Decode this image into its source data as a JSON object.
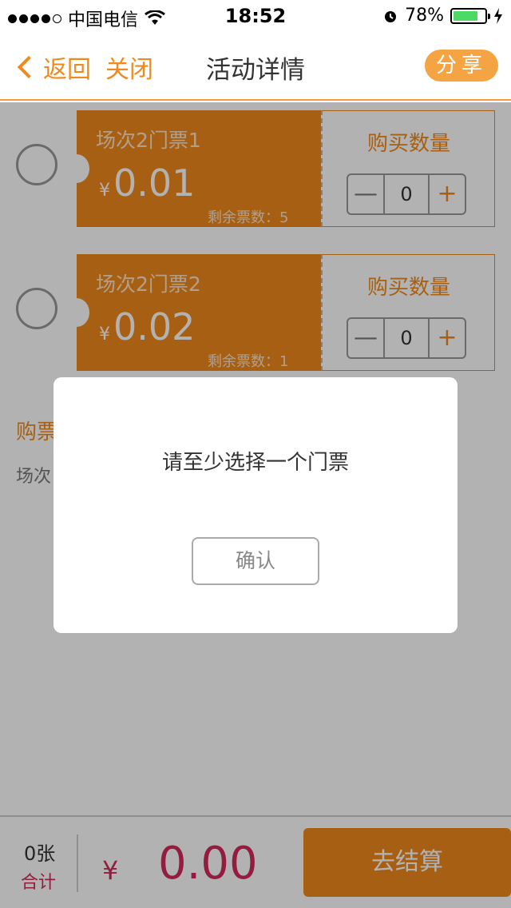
{
  "status_bar": {
    "carrier": "中国电信",
    "time": "18:52",
    "battery_percent": "78%",
    "battery_level": 0.78,
    "signal_dots_filled": 4
  },
  "nav": {
    "back_label": "返回",
    "close_label": "关闭",
    "title": "活动详情",
    "share_label": "分享"
  },
  "tickets": [
    {
      "name": "场次2门票1",
      "currency": "¥",
      "price": "0.01",
      "remaining": "剩余票数：5",
      "qty_label": "购买数量",
      "quantity": "0",
      "minus": "—",
      "plus": "+"
    },
    {
      "name": "场次2门票2",
      "currency": "¥",
      "price": "0.02",
      "remaining": "剩余票数：1",
      "qty_label": "购买数量",
      "quantity": "0",
      "minus": "—",
      "plus": "+"
    }
  ],
  "info": {
    "title_partial": "购票",
    "line_partial": "场次"
  },
  "bottom": {
    "count": "0张",
    "total_label": "合计",
    "currency": "¥",
    "amount": "0.00",
    "checkout_label": "去结算"
  },
  "dialog": {
    "message": "请至少选择一个门票",
    "confirm_label": "确认"
  },
  "colors": {
    "accent": "#f08a1c",
    "price": "#d22a5a",
    "battery": "#4cd964"
  }
}
